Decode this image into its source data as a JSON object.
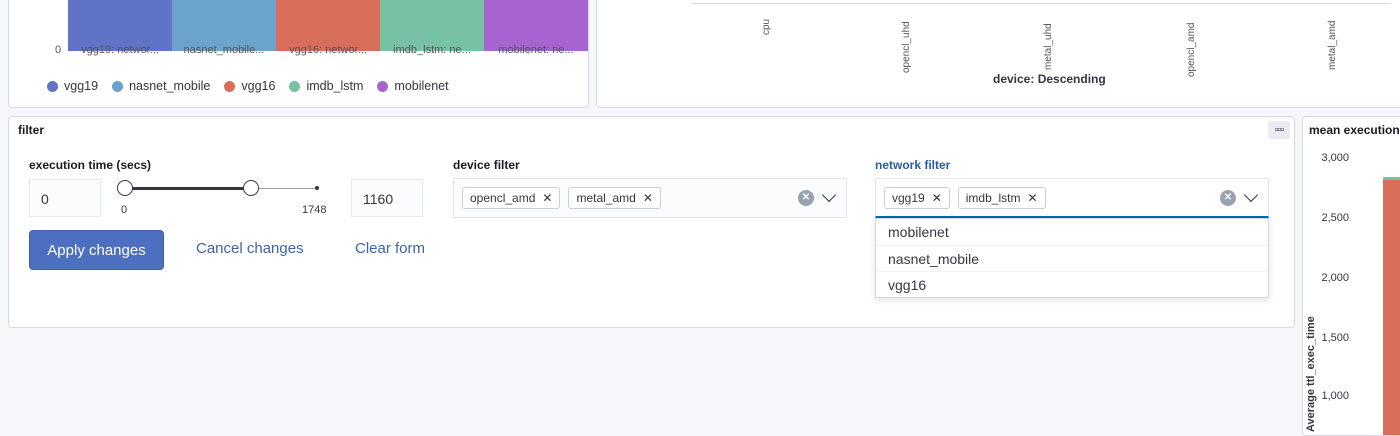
{
  "colors": {
    "vgg19": "#6173c7",
    "nasnet_mobile": "#6ba3cc",
    "vgg16": "#d86e5a",
    "imdb_lstm": "#77c2a5",
    "mobilenet": "#a764d1",
    "primary_button": "#4c6fbf",
    "link": "#3e63a8"
  },
  "top_left_chart": {
    "zero_label": "0",
    "bar_labels": [
      "vgg19: networ...",
      "nasnet_mobile...",
      "vgg16: networ...",
      "imdb_lstm: ne...",
      "mobilenet: ne..."
    ],
    "legend": [
      "vgg19",
      "nasnet_mobile",
      "vgg16",
      "imdb_lstm",
      "mobilenet"
    ]
  },
  "top_right_chart": {
    "x_ticks": [
      "cpu",
      "opencl_uhd",
      "metal_uhd",
      "opencl_amd",
      "metal_amd"
    ],
    "x_axis_title": "device: Descending"
  },
  "filter_panel": {
    "title": "filter",
    "menu_icon": "ellipsis-icon",
    "execution_time": {
      "label": "execution time (secs)",
      "min_value": "0",
      "max_value": "1160",
      "range_min_label": "0",
      "range_max_label": "1748"
    },
    "device_filter": {
      "label": "device filter",
      "selected": [
        "opencl_amd",
        "metal_amd"
      ]
    },
    "network_filter": {
      "label": "network filter",
      "selected": [
        "vgg19",
        "imdb_lstm"
      ],
      "options": [
        "mobilenet",
        "nasnet_mobile",
        "vgg16"
      ]
    },
    "buttons": {
      "apply": "Apply changes",
      "cancel": "Cancel changes",
      "clear": "Clear form"
    }
  },
  "mean_panel": {
    "title": "mean execution",
    "y_ticks": [
      "3,000",
      "2,500",
      "2,000",
      "1,500",
      "1,000"
    ],
    "y_title": "Average ttl_exec_time"
  }
}
